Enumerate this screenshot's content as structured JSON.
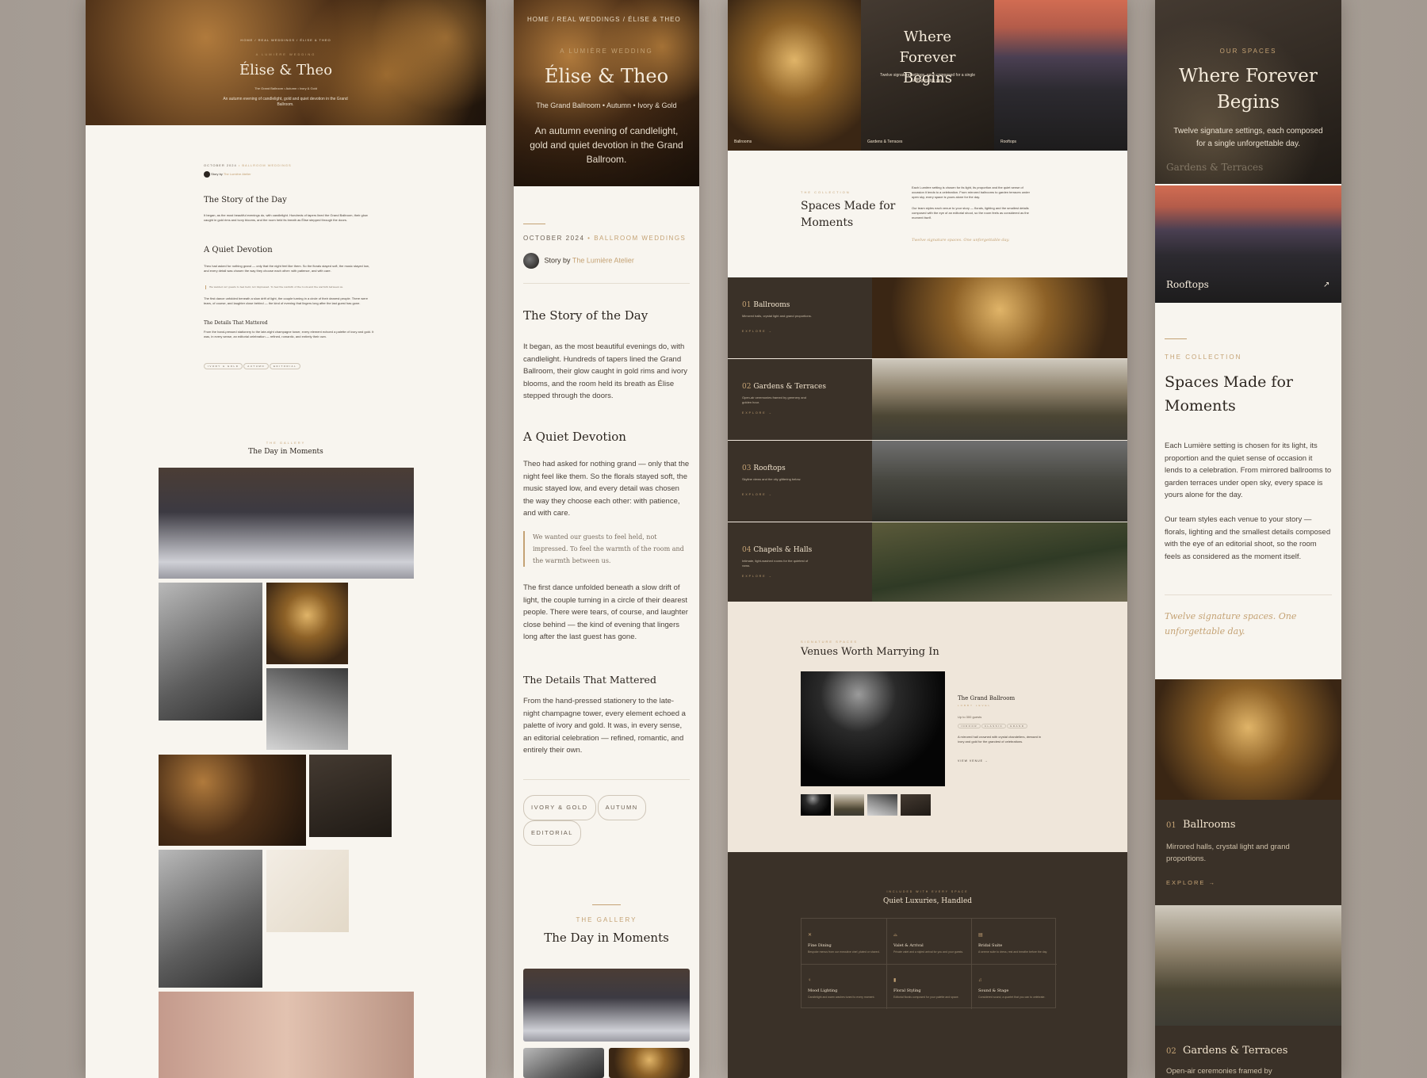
{
  "p1": {
    "breadcrumb": "HOME / REAL WEDDINGS / ÉLISE & THEO",
    "eyebrow": "A LUMIÈRE WEDDING",
    "title": "Élise & Theo",
    "meta": "The Grand Ballroom • Autumn • Ivory & Gold",
    "intro": "An autumn evening of candlelight, gold and quiet devotion in the Grand Ballroom.",
    "date": "OCTOBER 2024",
    "category": "• BALLROOM WEDDINGS",
    "story_by": "Story by",
    "author": "The Lumière Atelier",
    "h_story": "The Story of the Day",
    "p_story": "It began, as the most beautiful evenings do, with candlelight. Hundreds of tapers lined the Grand Ballroom, their glow caught in gold rims and ivory blooms, and the room held its breath as Élise stepped through the doors.",
    "h_quiet": "A Quiet Devotion",
    "p_quiet": "Theo had asked for nothing grand — only that the night feel like them. So the florals stayed soft, the music stayed low, and every detail was chosen the way they choose each other: with patience, and with care.",
    "quote": "We wanted our guests to feel held, not impressed. To feel the warmth of the room and the warmth between us.",
    "p_dance": "The first dance unfolded beneath a slow drift of light, the couple turning in a circle of their dearest people. There were tears, of course, and laughter close behind — the kind of evening that lingers long after the last guest has gone.",
    "h_details": "The Details That Mattered",
    "p_details": "From the hand-pressed stationery to the late-night champagne tower, every element echoed a palette of ivory and gold. It was, in every sense, an editorial celebration — refined, romantic, and entirely their own.",
    "tags": [
      "IVORY & GOLD",
      "AUTUMN",
      "EDITORIAL"
    ],
    "gallery_eyebrow": "THE GALLERY",
    "gallery_title": "The Day in Moments"
  },
  "p3": {
    "hero_title": "Where Forever Begins",
    "hero_sub": "Twelve signature settings, each composed for a single unforgettable day.",
    "hero_labels": [
      "Ballrooms",
      "Gardens & Terraces",
      "Rooftops"
    ],
    "collection_eyebrow": "THE COLLECTION",
    "collection_title": "Spaces Made for Moments",
    "collection_p1": "Each Lumière setting is chosen for its light, its proportion and the quiet sense of occasion it lends to a celebration. From mirrored ballrooms to garden terraces under open sky, every space is yours alone for the day.",
    "collection_p2": "Our team styles each venue to your story — florals, lighting and the smallest details composed with the eye of an editorial shoot, so the room feels as considered as the moment itself.",
    "collection_quote": "Twelve signature spaces. One unforgettable day.",
    "rows": [
      {
        "num": "01",
        "name": "Ballrooms",
        "desc": "Mirrored halls, crystal light and grand proportions.",
        "cta": "EXPLORE →"
      },
      {
        "num": "02",
        "name": "Gardens & Terraces",
        "desc": "Open-air ceremonies framed by greenery and golden hour.",
        "cta": "EXPLORE →"
      },
      {
        "num": "03",
        "name": "Rooftops",
        "desc": "Skyline views and the city glittering below.",
        "cta": "EXPLORE →"
      },
      {
        "num": "04",
        "name": "Chapels & Halls",
        "desc": "Intimate, light-washed rooms for the quietest of vows.",
        "cta": "EXPLORE →"
      }
    ],
    "venues_eyebrow": "SIGNATURE SPACES",
    "venues_title": "Venues Worth Marrying In",
    "venue_name": "The Grand Ballroom",
    "venue_sub": "LOBBY LEVEL",
    "venue_cap": "Up to 300 guests",
    "venue_tags": [
      "INDOOR",
      "CLASSIC",
      "GRAND"
    ],
    "venue_desc": "A mirrored hall crowned with crystal chandeliers, dressed in ivory and gold for the grandest of celebrations.",
    "venue_cta": "VIEW VENUE →",
    "lux_eyebrow": "INCLUDED WITH EVERY SPACE",
    "lux_title": "Quiet Luxuries, Handled",
    "lux": [
      {
        "icon": "✕",
        "name": "Fine Dining",
        "desc": "Bespoke menus from our executive chef, plated or shared."
      },
      {
        "icon": "⌓",
        "name": "Valet & Arrival",
        "desc": "Private valet and a styled arrival for you and your guests."
      },
      {
        "icon": "▤",
        "name": "Bridal Suite",
        "desc": "A serene suite to dress, rest and breathe before the day."
      },
      {
        "icon": "♀",
        "name": "Mood Lighting",
        "desc": "Candlelight and warm washes tuned to every moment."
      },
      {
        "icon": "▮",
        "name": "Floral Styling",
        "desc": "Editorial florals composed for your palette and space."
      },
      {
        "icon": "♫",
        "name": "Sound & Stage",
        "desc": "Considered sound, a quartet that you can to celebrate."
      }
    ]
  },
  "p4": {
    "eyebrow": "OUR SPACES",
    "title": "Where Forever Begins",
    "sub": "Twelve signature settings, each composed for a single unforgettable day.",
    "overlay_label": "Gardens & Terraces",
    "rooftops": "Rooftops",
    "arrow": "↗",
    "collection_eyebrow": "THE COLLECTION",
    "collection_title": "Spaces Made for Moments",
    "collection_p1": "Each Lumière setting is chosen for its light, its proportion and the quiet sense of occasion it lends to a celebration. From mirrored ballrooms to garden terraces under open sky, every space is yours alone for the day.",
    "collection_p2": "Our team styles each venue to your story — florals, lighting and the smallest details composed with the eye of an editorial shoot, so the room feels as considered as the moment itself.",
    "quote": "Twelve signature spaces. One unforgettable day.",
    "ball_num": "01",
    "ball_name": "Ballrooms",
    "ball_desc": "Mirrored halls, crystal light and grand proportions.",
    "ball_cta": "EXPLORE →",
    "gard_num": "02",
    "gard_name": "Gardens & Terraces",
    "gard_desc": "Open-air ceremonies framed by"
  }
}
